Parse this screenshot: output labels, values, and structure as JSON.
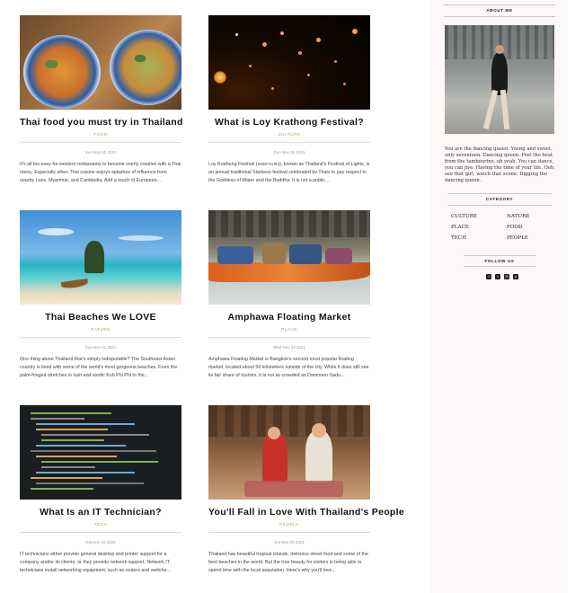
{
  "posts": [
    {
      "title": "Thai food you must try in Thailand",
      "category": "FOOD",
      "date": "Sun Nov 20 2021",
      "excerpt": "It's all too easy for western restaurants to become overly creative with a Thai menu. Especially when Thai cuisine enjoys splashes of influence from nearby Laos, Myanmar, and Cambodia. Add a touch of European..."
    },
    {
      "title": "What is Loy Krathong Festival?",
      "category": "CULTURE",
      "date": "Sun Nov 20 2021",
      "excerpt": "Loy Krathong Festival (ลอยกระทง), known as Thailand's Festival of Lights, is an annual traditional Siamese festival celebrated by Thais to pay respect to the Goddess of Water and the Buddha. It is not a public..."
    },
    {
      "title": "Thai Beaches We LOVE",
      "category": "NATURE",
      "date": "Sun Nov 21 2021",
      "excerpt": "One thing about Thailand that's simply indisputable? The Southeast Asian country is lined with some of the world's most gorgeous beaches. From the palm-fringed stretches in lush and exotic Koh Phi Phi to the..."
    },
    {
      "title": "Amphawa Floating Market",
      "category": "PLACE",
      "date": "Wed Nov 24 2021",
      "excerpt": "Amphawa Floating Market is Bangkok's second most popular floating market, located about 50 kilometers outside of the city. While it does still see its fair share of tourists, it is not as crowded as Damnoen Sadu..."
    },
    {
      "title": "What Is an IT Technician?",
      "category": "TECH",
      "date": "Sat Nov 20 2021",
      "excerpt": "IT technicians either provide general desktop and printer support for a company and/or its clients, or they provide network support. Network IT technicians install networking equipment, such as routers and switche..."
    },
    {
      "title": "You'll Fall in Love With Thailand's People",
      "category": "PEOPLE",
      "date": "Sat Nov 20 2021",
      "excerpt": "Thailand has beautiful tropical islands, delicious street food and some of the best beaches in the world. But the true beauty for visitors is being able to spend time with the local population. Here's why you'll love..."
    }
  ],
  "sidebar": {
    "about_heading": "ABOUT ME",
    "about_text": "You are the dancing queen. Young and sweet, only seventeen. Dancing queen. Feel the beat from the tambourine, oh yeah. You can dance, you can jive. Having the time of your life. Ooh, see that girl, watch that scene. Digging the dancing queen.",
    "category_heading": "CATEGORY",
    "categories": [
      "CULTURE",
      "NATURE",
      "PLACE",
      "FOOD",
      "TECH",
      "PEOPLE"
    ],
    "follow_heading": "FOLLOW US",
    "social_icons": [
      "facebook-icon",
      "twitter-icon",
      "instagram-icon",
      "pinterest-icon"
    ]
  }
}
